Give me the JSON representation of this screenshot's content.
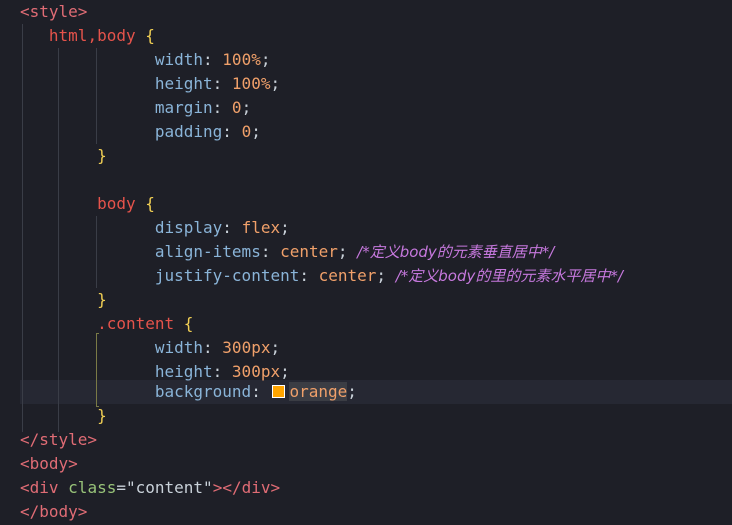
{
  "code": {
    "open_style": "<style>",
    "close_style": "</style>",
    "sel_htmlbody": "html,body",
    "sel_body": "body",
    "sel_content": ".content",
    "brace_open": "{",
    "brace_close": "}",
    "prop_width": "width",
    "prop_height": "height",
    "prop_margin": "margin",
    "prop_padding": "padding",
    "prop_display": "display",
    "prop_align": "align-items",
    "prop_justify": "justify-content",
    "prop_background": "background",
    "val_100": "100%",
    "val_0": "0",
    "val_flex": "flex",
    "val_center": "center",
    "val_300": "300px",
    "val_orange": "orange",
    "comment_align": "/*定义body的元素垂直居中*/",
    "comment_justify": "/*定义body的里的元素水平居中*/",
    "tag_body_open": "<body>",
    "tag_body_close": "</body>",
    "div_open": "<div",
    "div_attr": "class",
    "div_attr_value": "\"content\"",
    "div_close": "></div>",
    "swatch_color": "#ffa500"
  }
}
